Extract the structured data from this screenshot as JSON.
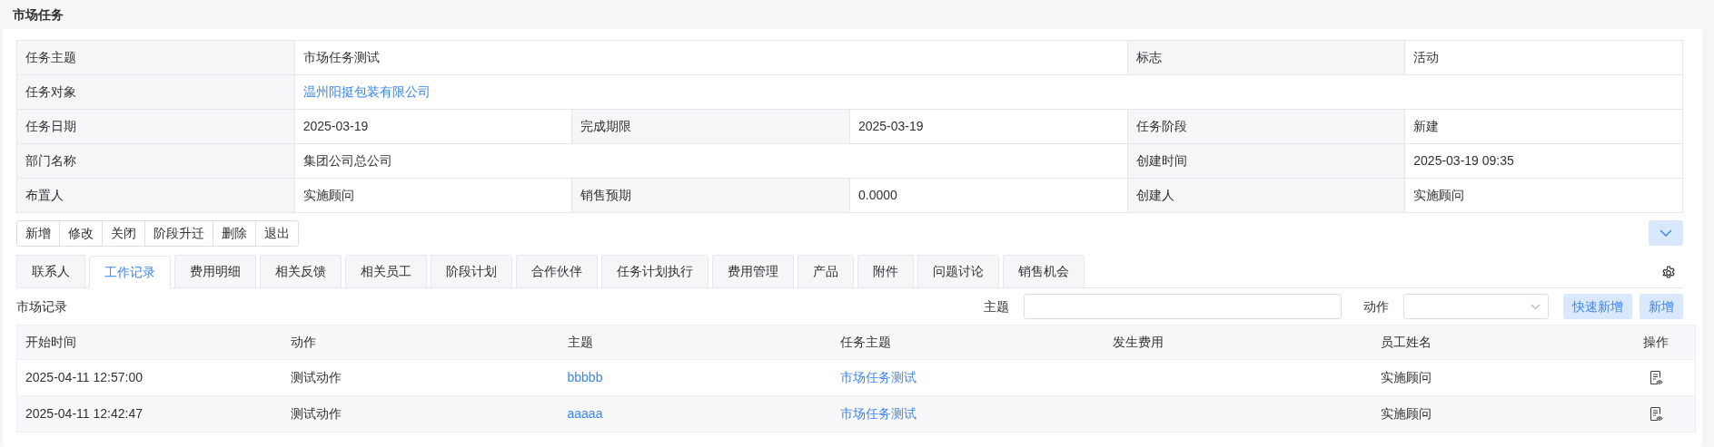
{
  "page_title": "市场任务",
  "details": [
    [
      {
        "kind": "label",
        "text": "任务主题"
      },
      {
        "kind": "value",
        "text": "市场任务测试"
      },
      {
        "kind": "label",
        "text": "标志"
      },
      {
        "kind": "value",
        "text": "活动"
      }
    ],
    [
      {
        "kind": "label",
        "text": "任务对象"
      },
      {
        "kind": "link",
        "text": "温州阳挺包装有限公司"
      }
    ],
    [
      {
        "kind": "label",
        "text": "任务日期"
      },
      {
        "kind": "value",
        "text": "2025-03-19"
      },
      {
        "kind": "label",
        "text": "完成期限"
      },
      {
        "kind": "value",
        "text": "2025-03-19"
      },
      {
        "kind": "label",
        "text": "任务阶段"
      },
      {
        "kind": "value",
        "text": "新建"
      }
    ],
    [
      {
        "kind": "label",
        "text": "部门名称"
      },
      {
        "kind": "value",
        "text": "集团公司总公司"
      },
      {
        "kind": "label",
        "text": "创建时间"
      },
      {
        "kind": "value",
        "text": "2025-03-19 09:35"
      }
    ],
    [
      {
        "kind": "label",
        "text": "布置人"
      },
      {
        "kind": "value",
        "text": "实施顾问"
      },
      {
        "kind": "label",
        "text": "销售预期"
      },
      {
        "kind": "value",
        "text": "0.0000"
      },
      {
        "kind": "label",
        "text": "创建人"
      },
      {
        "kind": "value",
        "text": "实施顾问"
      }
    ]
  ],
  "toolbar": [
    "新增",
    "修改",
    "关闭",
    "阶段升迁",
    "删除",
    "退出"
  ],
  "tabs": [
    {
      "label": "联系人",
      "selected": false
    },
    {
      "label": "工作记录",
      "selected": true
    },
    {
      "label": "费用明细",
      "selected": false
    },
    {
      "label": "相关反馈",
      "selected": false
    },
    {
      "label": "相关员工",
      "selected": false
    },
    {
      "label": "阶段计划",
      "selected": false
    },
    {
      "label": "合作伙伴",
      "selected": false
    },
    {
      "label": "任务计划执行",
      "selected": false
    },
    {
      "label": "费用管理",
      "selected": false
    },
    {
      "label": "产品",
      "selected": false
    },
    {
      "label": "附件",
      "selected": false
    },
    {
      "label": "问题讨论",
      "selected": false
    },
    {
      "label": "销售机会",
      "selected": false
    }
  ],
  "section_title": "市场记录",
  "filters": [
    {
      "kind": "text",
      "label": "主题"
    },
    {
      "kind": "select",
      "label": "动作"
    }
  ],
  "actions": [
    "快速新增",
    "新增"
  ],
  "table": {
    "columns": [
      "开始时间",
      "动作",
      "主题",
      "任务主题",
      "发生费用",
      "员工姓名",
      "操作"
    ],
    "rows": [
      {
        "cells": [
          {
            "kind": "text",
            "text": "2025-04-11 12:57:00"
          },
          {
            "kind": "text",
            "text": "测试动作"
          },
          {
            "kind": "link",
            "text": "bbbbb"
          },
          {
            "kind": "link",
            "text": "市场任务测试"
          },
          {
            "kind": "empty"
          },
          {
            "kind": "text",
            "text": "实施顾问"
          },
          {
            "kind": "icon"
          }
        ]
      },
      {
        "cells": [
          {
            "kind": "text",
            "text": "2025-04-11 12:42:47"
          },
          {
            "kind": "text",
            "text": "测试动作"
          },
          {
            "kind": "link",
            "text": "aaaaa"
          },
          {
            "kind": "link",
            "text": "市场任务测试"
          },
          {
            "kind": "empty"
          },
          {
            "kind": "text",
            "text": "实施顾问"
          },
          {
            "kind": "icon"
          }
        ]
      }
    ]
  }
}
